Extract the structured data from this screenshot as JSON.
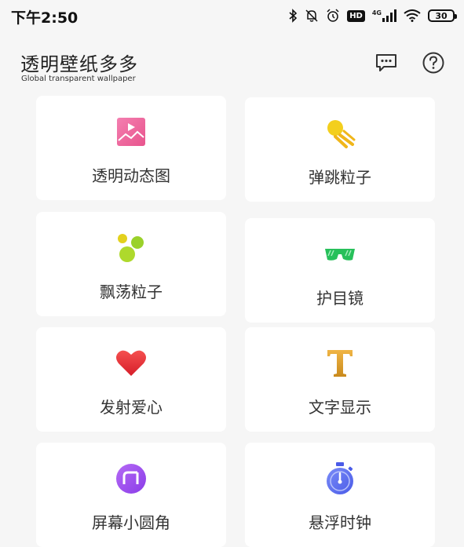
{
  "status_bar": {
    "time": "下午2:50",
    "hd": "HD",
    "network": "4G",
    "battery": "30"
  },
  "header": {
    "title": "透明壁纸多多",
    "subtitle": "Global transparent wallpaper"
  },
  "cards": [
    {
      "label": "透明动态图",
      "icon": "animated-picture-icon"
    },
    {
      "label": "弹跳粒子",
      "icon": "bouncing-particle-icon"
    },
    {
      "label": "飘荡粒子",
      "icon": "floating-particle-icon"
    },
    {
      "label": "护目镜",
      "icon": "goggles-icon"
    },
    {
      "label": "发射爱心",
      "icon": "heart-icon"
    },
    {
      "label": "文字显示",
      "icon": "text-icon"
    },
    {
      "label": "屏幕小圆角",
      "icon": "rounded-corner-icon"
    },
    {
      "label": "悬浮时钟",
      "icon": "clock-icon"
    }
  ],
  "colors": {
    "background": "#f6f6f6",
    "card": "#ffffff",
    "pink": "#f06ea0",
    "yellow": "#f3cf1d",
    "green": "#27c05a",
    "red": "#e6303a",
    "gold": "#d99a2a",
    "purple": "#9a4cf0",
    "blue": "#5a6ef0"
  }
}
